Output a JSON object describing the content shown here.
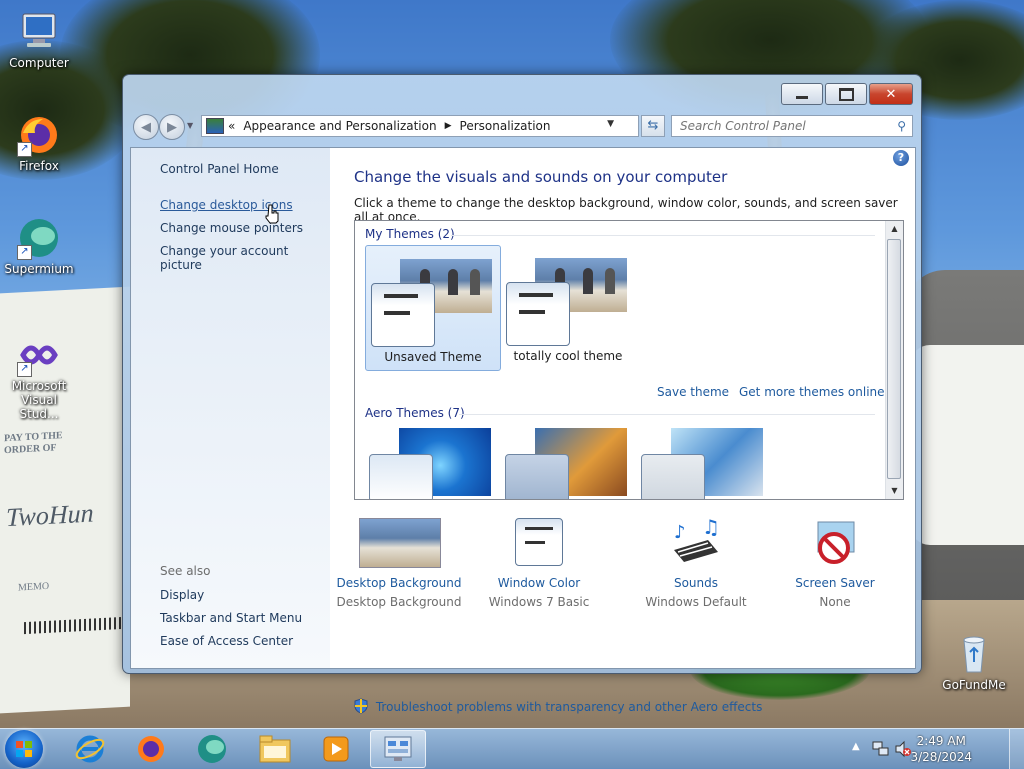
{
  "desktop": {
    "icons": [
      {
        "label": "Computer",
        "icon": "computer-icon"
      },
      {
        "label": "Firefox",
        "icon": "firefox-icon"
      },
      {
        "label": "Supermium",
        "icon": "supermium-icon"
      },
      {
        "label": "Microsoft Visual Stud...",
        "icon": "visual-studio-icon"
      },
      {
        "label": "GoFundMe",
        "icon": "recycle-bin-icon"
      }
    ],
    "background_text": {
      "pay_to": "PAY TO THE",
      "order_of": "ORDER OF",
      "amount": "TwoHun",
      "memo": "MEMO"
    }
  },
  "window": {
    "title": "Personalization",
    "breadcrumb": [
      "Appearance and Personalization",
      "Personalization"
    ],
    "breadcrumb_chevrons": "«",
    "search_placeholder": "Search Control Panel",
    "left_nav": {
      "home": "Control Panel Home",
      "links": [
        "Change desktop icons",
        "Change mouse pointers",
        "Change your account picture"
      ],
      "see_also_title": "See also",
      "see_also": [
        "Display",
        "Taskbar and Start Menu",
        "Ease of Access Center"
      ]
    },
    "main": {
      "heading": "Change the visuals and sounds on your computer",
      "subheading": "Click a theme to change the desktop background, window color, sounds, and screen saver all at once.",
      "my_themes_title": "My Themes (2)",
      "my_themes": [
        {
          "name": "Unsaved Theme",
          "selected": true
        },
        {
          "name": "totally cool theme",
          "selected": false
        }
      ],
      "save_theme": "Save theme",
      "get_more": "Get more themes online",
      "aero_themes_title": "Aero Themes (7)",
      "bottom_items": [
        {
          "title": "Desktop Background",
          "value": "Desktop Background",
          "icon": "desktop-background-icon"
        },
        {
          "title": "Window Color",
          "value": "Windows 7 Basic",
          "icon": "window-color-icon"
        },
        {
          "title": "Sounds",
          "value": "Windows Default",
          "icon": "sounds-icon"
        },
        {
          "title": "Screen Saver",
          "value": "None",
          "icon": "screen-saver-icon"
        }
      ],
      "troubleshoot": "Troubleshoot problems with transparency and other Aero effects"
    }
  },
  "taskbar": {
    "apps": [
      "internet-explorer-icon",
      "firefox-icon",
      "supermium-icon",
      "file-explorer-icon",
      "media-player-icon",
      "control-panel-icon"
    ],
    "time": "2:49 AM",
    "date": "3/28/2024"
  },
  "colors": {
    "link": "#1e5a9e",
    "heading": "#1e3287",
    "close_button": "#c8452d"
  }
}
